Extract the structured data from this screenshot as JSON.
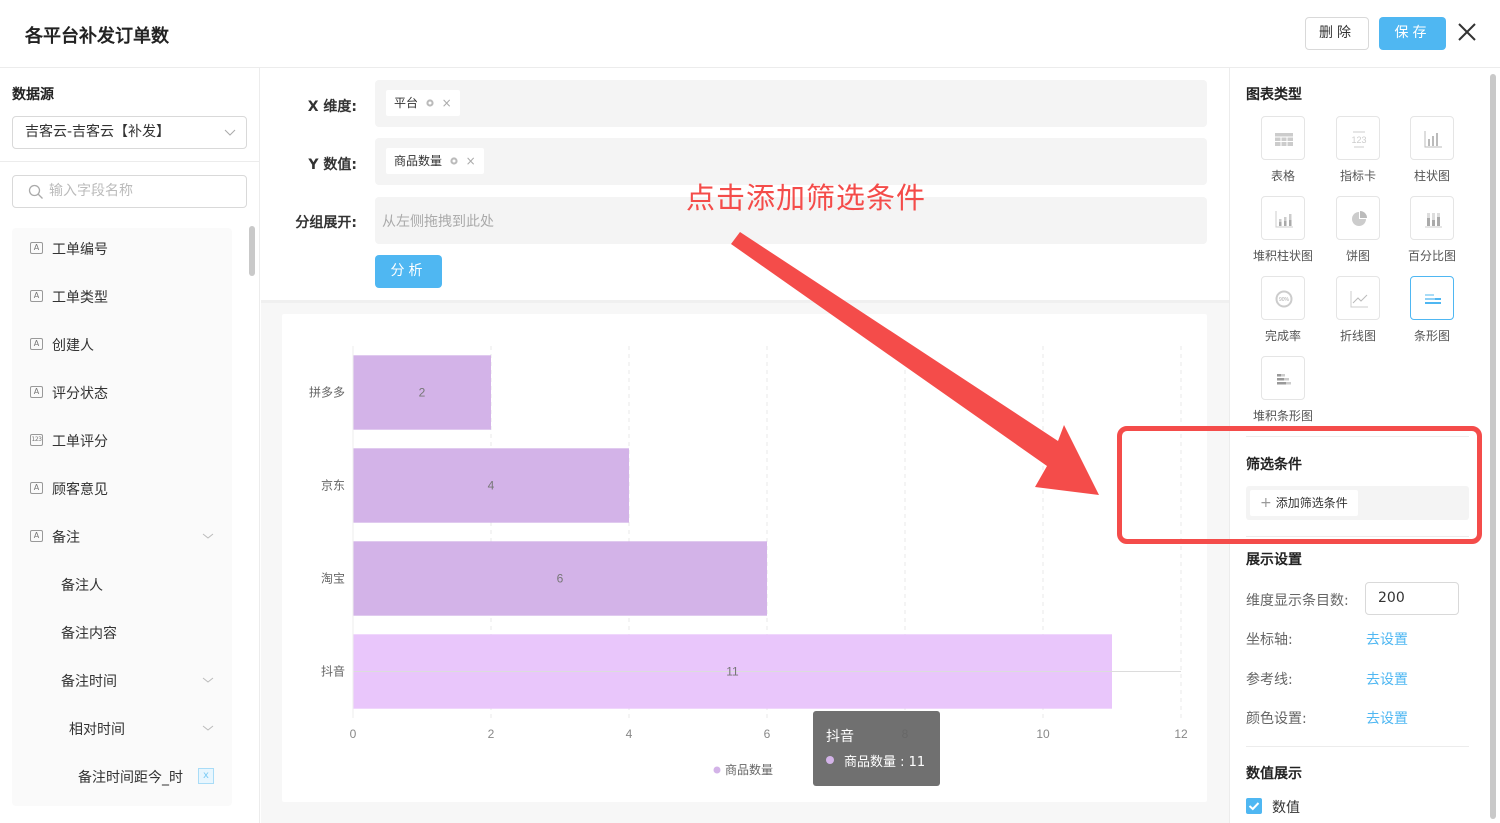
{
  "header": {
    "title": "各平台补发订单数",
    "delete_label": "删除",
    "save_label": "保存",
    "close_icon": "close-icon"
  },
  "sidebar": {
    "datasource_label": "数据源",
    "datasource_value": "吉客云-吉客云【补发】",
    "search_placeholder": "输入字段名称",
    "fields": [
      {
        "label": "工单编号",
        "type": "text",
        "icon": "A",
        "level": 0,
        "expandable": false
      },
      {
        "label": "工单类型",
        "type": "text",
        "icon": "A",
        "level": 0,
        "expandable": false
      },
      {
        "label": "创建人",
        "type": "text",
        "icon": "A",
        "level": 0,
        "expandable": false
      },
      {
        "label": "评分状态",
        "type": "text",
        "icon": "A",
        "level": 0,
        "expandable": false
      },
      {
        "label": "工单评分",
        "type": "number",
        "icon": "123",
        "level": 0,
        "expandable": false
      },
      {
        "label": "顾客意见",
        "type": "text",
        "icon": "A",
        "level": 0,
        "expandable": false
      },
      {
        "label": "备注",
        "type": "text",
        "icon": "A",
        "level": 0,
        "expandable": true
      },
      {
        "label": "备注人",
        "type": "text",
        "icon": "",
        "level": 1,
        "expandable": false
      },
      {
        "label": "备注内容",
        "type": "text",
        "icon": "",
        "level": 1,
        "expandable": false
      },
      {
        "label": "备注时间",
        "type": "text",
        "icon": "",
        "level": 1,
        "expandable": true
      },
      {
        "label": "相对时间",
        "type": "text",
        "icon": "",
        "level": 2,
        "expandable": true
      },
      {
        "label": "备注时间距今_时",
        "type": "text",
        "icon": "",
        "level": 3,
        "expandable": false,
        "badge": "x"
      }
    ]
  },
  "config": {
    "x_label": "X 维度:",
    "x_tag": "平台",
    "y_label": "Y 数值:",
    "y_tag": "商品数量",
    "group_label": "分组展开:",
    "group_placeholder": "从左侧拖拽到此处",
    "analyze_label": "分析"
  },
  "chart_data": {
    "type": "bar",
    "orientation": "horizontal",
    "title": "",
    "categories": [
      "拼多多",
      "京东",
      "淘宝",
      "抖音"
    ],
    "series": [
      {
        "name": "商品数量",
        "values": [
          2,
          4,
          6,
          11
        ],
        "color": "#d3b3e8",
        "highlight_color": "#e9c6fb"
      }
    ],
    "highlighted_category": "抖音",
    "xlabel": "",
    "ylabel": "",
    "xlim": [
      0,
      12
    ],
    "xticks": [
      0,
      2,
      4,
      6,
      8,
      10,
      12
    ],
    "grid": true,
    "legend": "bottom-center",
    "data_labels": true
  },
  "tooltip": {
    "title": "抖音",
    "series_name": "商品数量",
    "value": "11",
    "row_text": "商品数量 : 11"
  },
  "right_panel": {
    "chart_type_title": "图表类型",
    "chart_types": [
      {
        "label": "表格",
        "icon": "table-chart-icon",
        "active": false
      },
      {
        "label": "指标卡",
        "icon": "metric-card-icon",
        "active": false
      },
      {
        "label": "柱状图",
        "icon": "column-chart-icon",
        "active": false
      },
      {
        "label": "堆积柱状图",
        "icon": "stacked-column-chart-icon",
        "active": false
      },
      {
        "label": "饼图",
        "icon": "pie-chart-icon",
        "active": false
      },
      {
        "label": "百分比图",
        "icon": "percent-chart-icon",
        "active": false
      },
      {
        "label": "完成率",
        "icon": "completion-rate-icon",
        "active": false
      },
      {
        "label": "折线图",
        "icon": "line-chart-icon",
        "active": false
      },
      {
        "label": "条形图",
        "icon": "bar-chart-icon",
        "active": true
      },
      {
        "label": "堆积条形图",
        "icon": "stacked-bar-chart-icon",
        "active": false
      }
    ],
    "filter_title": "筛选条件",
    "add_filter_label": "添加筛选条件",
    "display_title": "展示设置",
    "dim_count_label": "维度显示条目数:",
    "dim_count_value": "200",
    "axis_label": "坐标轴:",
    "refline_label": "参考线:",
    "color_label": "颜色设置:",
    "set_link": "去设置",
    "value_display_title": "数值展示",
    "value_checkbox_label": "数值",
    "value_checkbox_checked": true
  },
  "annotation": {
    "text": "点击添加筛选条件",
    "color": "#f44c4a"
  },
  "colors": {
    "accent": "#4fb7f2",
    "bar": "#d3b3e8",
    "bar_highlight": "#e9c6fb",
    "annotation": "#f44c4a"
  }
}
